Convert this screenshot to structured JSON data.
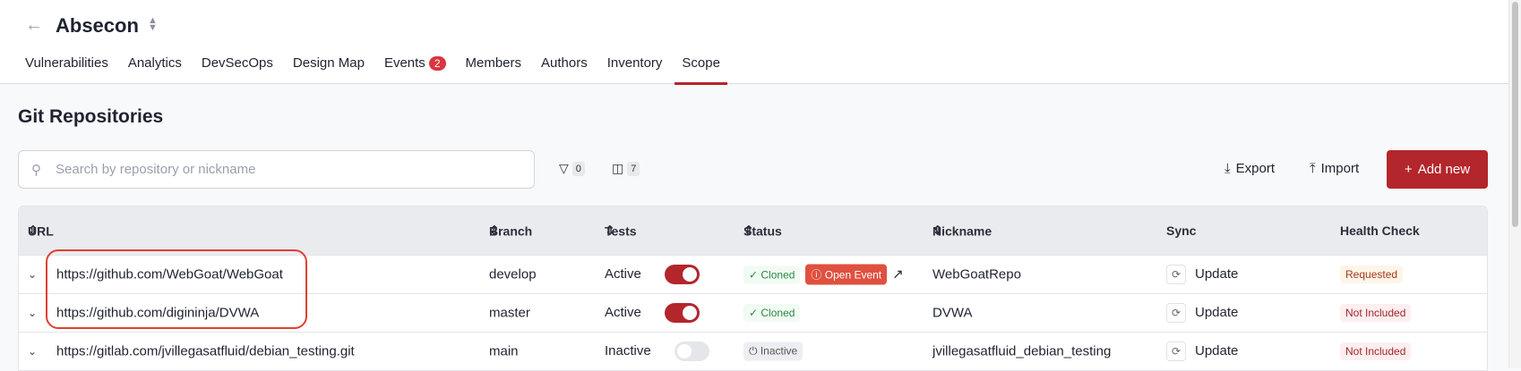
{
  "header": {
    "title": "Absecon"
  },
  "tabs": [
    {
      "label": "Vulnerabilities"
    },
    {
      "label": "Analytics"
    },
    {
      "label": "DevSecOps"
    },
    {
      "label": "Design Map"
    },
    {
      "label": "Events",
      "badge": "2"
    },
    {
      "label": "Members"
    },
    {
      "label": "Authors"
    },
    {
      "label": "Inventory"
    },
    {
      "label": "Scope"
    }
  ],
  "section_title": "Git Repositories",
  "search": {
    "placeholder": "Search by repository or nickname"
  },
  "filters_count": "0",
  "columns_count": "7",
  "actions": {
    "export": "Export",
    "import": "Import",
    "add": "Add new"
  },
  "columns": [
    "URL",
    "Branch",
    "Tests",
    "Status",
    "Nickname",
    "Sync",
    "Health Check"
  ],
  "rows": [
    {
      "url": "https://github.com/WebGoat/WebGoat",
      "branch": "develop",
      "tests": "Active",
      "status": "Cloned",
      "event": "Open Event",
      "nickname": "WebGoatRepo",
      "sync": "Update",
      "health": "Requested"
    },
    {
      "url": "https://github.com/digininja/DVWA",
      "branch": "master",
      "tests": "Active",
      "status": "Cloned",
      "nickname": "DVWA",
      "sync": "Update",
      "health": "Not Included"
    },
    {
      "url": "https://gitlab.com/jvillegasatfluid/debian_testing.git",
      "branch": "main",
      "tests": "Inactive",
      "status": "Inactive",
      "nickname": "jvillegasatfluid_debian_testing",
      "sync": "Update",
      "health": "Not Included"
    }
  ],
  "colors": {
    "accent": "#b3262b"
  }
}
